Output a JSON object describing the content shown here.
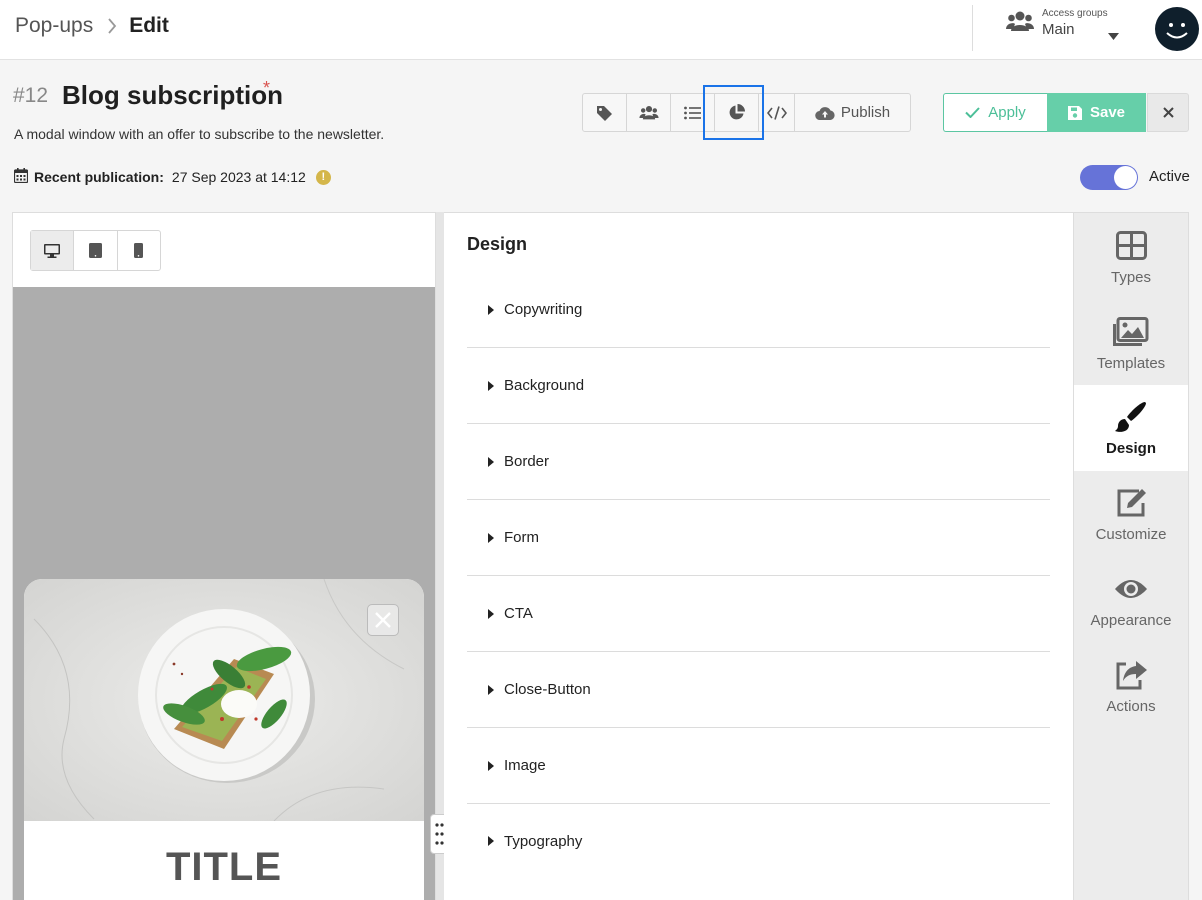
{
  "breadcrumb": {
    "parent": "Pop-ups",
    "current": "Edit"
  },
  "access": {
    "caption": "Access groups",
    "value": "Main"
  },
  "popup": {
    "number": "#12",
    "title": "Blog subscription",
    "required_mark": "*",
    "description": "A modal window with an offer to subscribe to the newsletter.",
    "recent_label": "Recent publication:",
    "recent_value": "27 Sep 2023 at 14:12",
    "warning_glyph": "!"
  },
  "toolbar": {
    "icons": [
      "tag-icon",
      "users-icon",
      "list-icon",
      "pie-chart-icon",
      "code-icon"
    ],
    "publish_label": "Publish"
  },
  "actions": {
    "apply_label": "Apply",
    "save_label": "Save"
  },
  "active": {
    "label": "Active",
    "on": true
  },
  "preview": {
    "devices": [
      "desktop-icon",
      "tablet-icon",
      "mobile-icon"
    ],
    "selected_device": "desktop",
    "popup_title": "TITLE"
  },
  "design": {
    "title": "Design",
    "sections": [
      "Copywriting",
      "Background",
      "Border",
      "Form",
      "CTA",
      "Close-Button",
      "Image",
      "Typography"
    ]
  },
  "sidebar": {
    "items": [
      {
        "label": "Types",
        "icon": "grid-icon"
      },
      {
        "label": "Templates",
        "icon": "images-icon"
      },
      {
        "label": "Design",
        "icon": "brush-icon",
        "selected": true
      },
      {
        "label": "Customize",
        "icon": "edit-icon"
      },
      {
        "label": "Appearance",
        "icon": "eye-icon"
      },
      {
        "label": "Actions",
        "icon": "share-icon"
      }
    ]
  },
  "colors": {
    "accent_blue": "#1a73e8",
    "toggle": "#6673d8",
    "save_green": "#66cfa9",
    "apply_green": "#4cbf98",
    "required_red": "#d9534f",
    "warning": "#d4b64a"
  }
}
